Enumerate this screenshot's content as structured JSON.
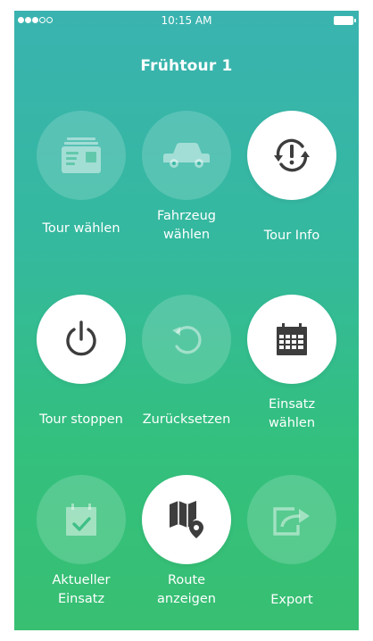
{
  "status_bar": {
    "time": "10:15 AM"
  },
  "header": {
    "title": "Frühtour 1"
  },
  "menu": {
    "tour_waehlen": "Tour wählen",
    "fahrzeug_waehlen": "Fahrzeug\nwählen",
    "tour_info": "Tour Info",
    "tour_stoppen": "Tour stoppen",
    "zuruecksetzen": "Zurücksetzen",
    "einsatz_waehlen": "Einsatz\nwählen",
    "aktueller_einsatz": "Aktueller\nEinsatz",
    "route_anzeigen": "Route\nanzeigen",
    "export": "Export"
  },
  "colors": {
    "gradient_top": "#3ab3b0",
    "gradient_bottom": "#38bf72",
    "icon_dark": "#3d3d3d",
    "disabled_icon": "#ffffff"
  }
}
